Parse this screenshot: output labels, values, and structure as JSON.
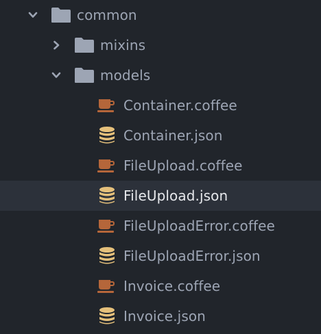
{
  "colors": {
    "background": "#21252b",
    "selected_row": "#2c313a",
    "text": "#9da5b4",
    "text_selected": "#e6e8ec",
    "folder_icon": "#9da5b4",
    "coffee_icon": "#b5663a",
    "json_icon": "#e5c07b"
  },
  "tree": {
    "common": {
      "label": "common",
      "state": "expanded",
      "icon": "folder-icon"
    },
    "mixins": {
      "label": "mixins",
      "state": "collapsed",
      "icon": "folder-icon"
    },
    "models": {
      "label": "models",
      "state": "expanded",
      "icon": "folder-icon"
    },
    "files": [
      {
        "label": "Container.coffee",
        "icon": "coffee-cup-icon"
      },
      {
        "label": "Container.json",
        "icon": "database-icon"
      },
      {
        "label": "FileUpload.coffee",
        "icon": "coffee-cup-icon"
      },
      {
        "label": "FileUpload.json",
        "icon": "database-icon",
        "selected": true
      },
      {
        "label": "FileUploadError.coffee",
        "icon": "coffee-cup-icon"
      },
      {
        "label": "FileUploadError.json",
        "icon": "database-icon"
      },
      {
        "label": "Invoice.coffee",
        "icon": "coffee-cup-icon"
      },
      {
        "label": "Invoice.json",
        "icon": "database-icon"
      }
    ]
  }
}
